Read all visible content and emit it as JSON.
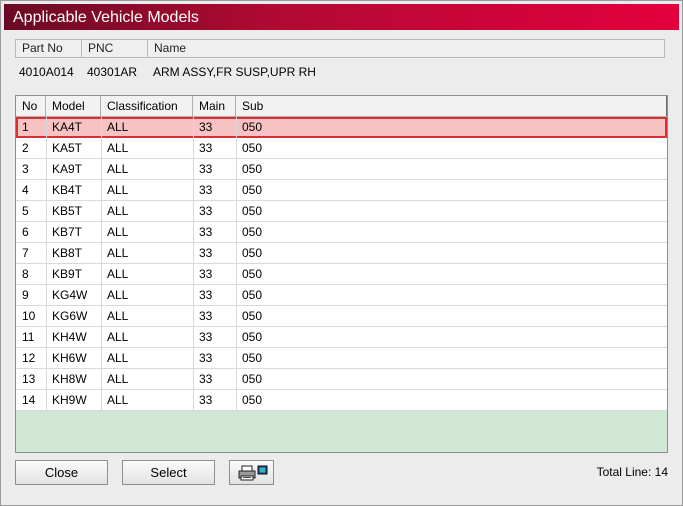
{
  "window": {
    "title": "Applicable Vehicle Models"
  },
  "part": {
    "headers": {
      "part_no": "Part No",
      "pnc": "PNC",
      "name": "Name"
    },
    "values": {
      "part_no": "4010A014",
      "pnc": "40301AR",
      "name": "ARM ASSY,FR SUSP,UPR RH"
    }
  },
  "table": {
    "columns": {
      "no": "No",
      "model": "Model",
      "classification": "Classification",
      "main": "Main",
      "sub": "Sub"
    },
    "rows": [
      {
        "no": "1",
        "model": "KA4T",
        "classification": "ALL",
        "main": "33",
        "sub": "050"
      },
      {
        "no": "2",
        "model": "KA5T",
        "classification": "ALL",
        "main": "33",
        "sub": "050"
      },
      {
        "no": "3",
        "model": "KA9T",
        "classification": "ALL",
        "main": "33",
        "sub": "050"
      },
      {
        "no": "4",
        "model": "KB4T",
        "classification": "ALL",
        "main": "33",
        "sub": "050"
      },
      {
        "no": "5",
        "model": "KB5T",
        "classification": "ALL",
        "main": "33",
        "sub": "050"
      },
      {
        "no": "6",
        "model": "KB7T",
        "classification": "ALL",
        "main": "33",
        "sub": "050"
      },
      {
        "no": "7",
        "model": "KB8T",
        "classification": "ALL",
        "main": "33",
        "sub": "050"
      },
      {
        "no": "8",
        "model": "KB9T",
        "classification": "ALL",
        "main": "33",
        "sub": "050"
      },
      {
        "no": "9",
        "model": "KG4W",
        "classification": "ALL",
        "main": "33",
        "sub": "050"
      },
      {
        "no": "10",
        "model": "KG6W",
        "classification": "ALL",
        "main": "33",
        "sub": "050"
      },
      {
        "no": "11",
        "model": "KH4W",
        "classification": "ALL",
        "main": "33",
        "sub": "050"
      },
      {
        "no": "12",
        "model": "KH6W",
        "classification": "ALL",
        "main": "33",
        "sub": "050"
      },
      {
        "no": "13",
        "model": "KH8W",
        "classification": "ALL",
        "main": "33",
        "sub": "050"
      },
      {
        "no": "14",
        "model": "KH9W",
        "classification": "ALL",
        "main": "33",
        "sub": "050"
      }
    ],
    "selected_row": "1"
  },
  "buttons": {
    "close": "Close",
    "select": "Select",
    "print_icon": "printer-icon"
  },
  "footer": {
    "total_line": "Total Line: 14"
  },
  "colors": {
    "title_start": "#6a0a24",
    "title_end": "#e4003c",
    "selection": "#f7c2c2",
    "selection_border": "#d83030",
    "empty_area": "#cfe7d3"
  }
}
